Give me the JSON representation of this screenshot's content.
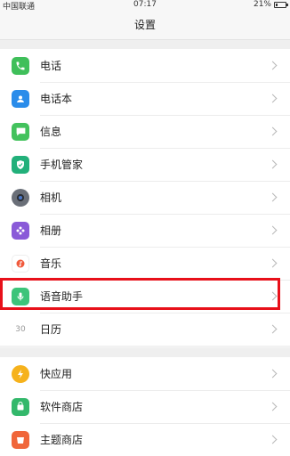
{
  "status_bar": {
    "carrier": "中国联通",
    "time": "07:17",
    "battery": "21%",
    "battery_level": 0.21
  },
  "header": {
    "title": "设置"
  },
  "settings_group_1": [
    {
      "label": "电话",
      "icon": "phone-icon",
      "color": "#3fbf5a"
    },
    {
      "label": "电话本",
      "icon": "contacts-icon",
      "color": "#2a8cea"
    },
    {
      "label": "信息",
      "icon": "message-icon",
      "color": "#43c25d"
    },
    {
      "label": "手机管家",
      "icon": "shield-icon",
      "color": "#22b07a"
    },
    {
      "label": "相机",
      "icon": "camera-icon",
      "color": "#6a6f78"
    },
    {
      "label": "相册",
      "icon": "gallery-icon",
      "color": "#8a5ad8"
    },
    {
      "label": "音乐",
      "icon": "music-icon",
      "color": "#f05a3c"
    },
    {
      "label": "语音助手",
      "icon": "voice-assistant-icon",
      "color": "#3cc47a"
    },
    {
      "label": "日历",
      "icon": "calendar-icon",
      "color": "#ffffff"
    }
  ],
  "calendar_icon_number": "30",
  "settings_group_2": [
    {
      "label": "快应用",
      "icon": "quick-app-icon",
      "color": "#f6b21c"
    },
    {
      "label": "软件商店",
      "icon": "app-store-icon",
      "color": "#33b86b"
    },
    {
      "label": "主题商店",
      "icon": "theme-store-icon",
      "color": "#f0663a"
    }
  ],
  "highlight_color": "#e8101a"
}
